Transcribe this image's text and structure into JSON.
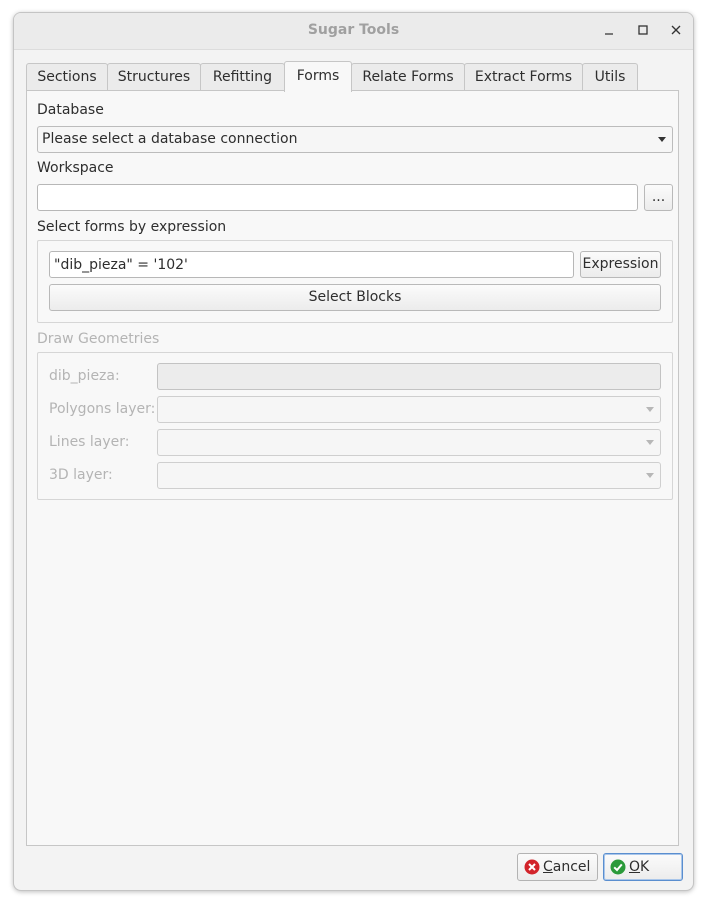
{
  "window": {
    "title": "Sugar Tools",
    "controls": [
      "minimize-icon",
      "maximize-icon",
      "close-icon"
    ]
  },
  "tabs": [
    {
      "label": "Sections"
    },
    {
      "label": "Structures"
    },
    {
      "label": "Refitting"
    },
    {
      "label": "Forms",
      "active": true
    },
    {
      "label": "Relate Forms"
    },
    {
      "label": "Extract Forms"
    },
    {
      "label": "Utils"
    }
  ],
  "forms": {
    "database_label": "Database",
    "database_value": "Please select a database connection",
    "workspace_label": "Workspace",
    "workspace_value": "",
    "browse_label": "...",
    "select_group_label": "Select forms by expression",
    "expression_value": "\"dib_pieza\" = '102'",
    "expression_button": "Expression",
    "select_blocks_button": "Select Blocks",
    "draw_group_label": "Draw Geometries",
    "draw_fields": [
      {
        "label": "dib_pieza:",
        "kind": "text"
      },
      {
        "label": "Polygons layer:",
        "kind": "combo"
      },
      {
        "label": "Lines layer:",
        "kind": "combo"
      },
      {
        "label": "3D layer:",
        "kind": "combo"
      }
    ]
  },
  "dialog": {
    "cancel": {
      "mnemonic": "C",
      "rest": "ancel",
      "icon": "cancel-icon"
    },
    "ok": {
      "mnemonic": "O",
      "rest": "K",
      "icon": "ok-check-icon"
    }
  },
  "colors": {
    "cancel_icon": "#d2232a",
    "ok_icon": "#2a9a3a",
    "default_button_border": "#5a8ecf"
  }
}
